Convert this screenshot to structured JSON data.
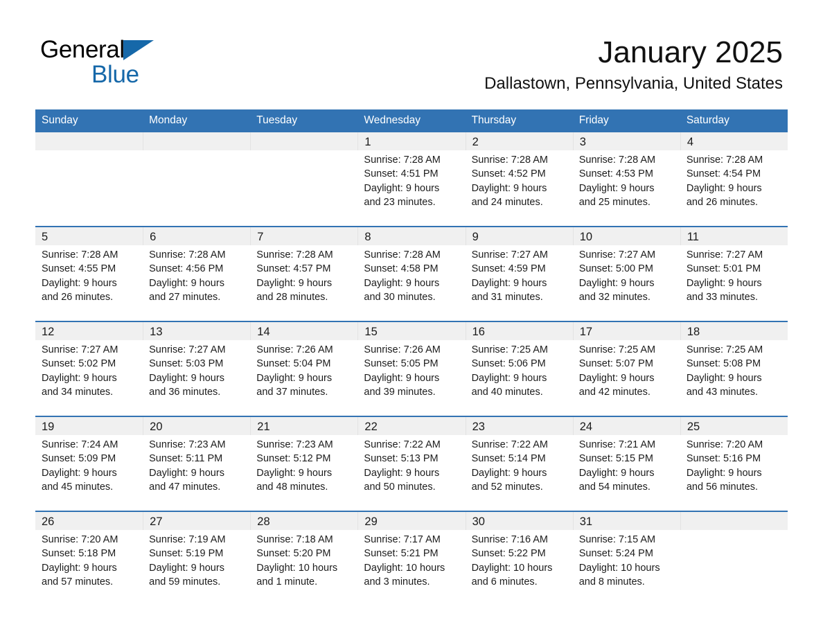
{
  "brand": {
    "name_part1": "General",
    "name_part2": "Blue",
    "triangle_color": "#1668A9"
  },
  "header": {
    "month_title": "January 2025",
    "location": "Dallastown, Pennsylvania, United States"
  },
  "colors": {
    "header_blue": "#3273B3",
    "daynum_band": "#f0f0f0",
    "row_divider": "#3273B3"
  },
  "weekday_headers": [
    "Sunday",
    "Monday",
    "Tuesday",
    "Wednesday",
    "Thursday",
    "Friday",
    "Saturday"
  ],
  "labels": {
    "sunrise_prefix": "Sunrise:",
    "sunset_prefix": "Sunset:",
    "daylight_prefix": "Daylight:"
  },
  "weeks": [
    [
      {
        "day": "",
        "empty": true
      },
      {
        "day": "",
        "empty": true
      },
      {
        "day": "",
        "empty": true
      },
      {
        "day": "1",
        "sunrise": "Sunrise: 7:28 AM",
        "sunset": "Sunset: 4:51 PM",
        "daylight_l1": "Daylight: 9 hours",
        "daylight_l2": "and 23 minutes."
      },
      {
        "day": "2",
        "sunrise": "Sunrise: 7:28 AM",
        "sunset": "Sunset: 4:52 PM",
        "daylight_l1": "Daylight: 9 hours",
        "daylight_l2": "and 24 minutes."
      },
      {
        "day": "3",
        "sunrise": "Sunrise: 7:28 AM",
        "sunset": "Sunset: 4:53 PM",
        "daylight_l1": "Daylight: 9 hours",
        "daylight_l2": "and 25 minutes."
      },
      {
        "day": "4",
        "sunrise": "Sunrise: 7:28 AM",
        "sunset": "Sunset: 4:54 PM",
        "daylight_l1": "Daylight: 9 hours",
        "daylight_l2": "and 26 minutes."
      }
    ],
    [
      {
        "day": "5",
        "sunrise": "Sunrise: 7:28 AM",
        "sunset": "Sunset: 4:55 PM",
        "daylight_l1": "Daylight: 9 hours",
        "daylight_l2": "and 26 minutes."
      },
      {
        "day": "6",
        "sunrise": "Sunrise: 7:28 AM",
        "sunset": "Sunset: 4:56 PM",
        "daylight_l1": "Daylight: 9 hours",
        "daylight_l2": "and 27 minutes."
      },
      {
        "day": "7",
        "sunrise": "Sunrise: 7:28 AM",
        "sunset": "Sunset: 4:57 PM",
        "daylight_l1": "Daylight: 9 hours",
        "daylight_l2": "and 28 minutes."
      },
      {
        "day": "8",
        "sunrise": "Sunrise: 7:28 AM",
        "sunset": "Sunset: 4:58 PM",
        "daylight_l1": "Daylight: 9 hours",
        "daylight_l2": "and 30 minutes."
      },
      {
        "day": "9",
        "sunrise": "Sunrise: 7:27 AM",
        "sunset": "Sunset: 4:59 PM",
        "daylight_l1": "Daylight: 9 hours",
        "daylight_l2": "and 31 minutes."
      },
      {
        "day": "10",
        "sunrise": "Sunrise: 7:27 AM",
        "sunset": "Sunset: 5:00 PM",
        "daylight_l1": "Daylight: 9 hours",
        "daylight_l2": "and 32 minutes."
      },
      {
        "day": "11",
        "sunrise": "Sunrise: 7:27 AM",
        "sunset": "Sunset: 5:01 PM",
        "daylight_l1": "Daylight: 9 hours",
        "daylight_l2": "and 33 minutes."
      }
    ],
    [
      {
        "day": "12",
        "sunrise": "Sunrise: 7:27 AM",
        "sunset": "Sunset: 5:02 PM",
        "daylight_l1": "Daylight: 9 hours",
        "daylight_l2": "and 34 minutes."
      },
      {
        "day": "13",
        "sunrise": "Sunrise: 7:27 AM",
        "sunset": "Sunset: 5:03 PM",
        "daylight_l1": "Daylight: 9 hours",
        "daylight_l2": "and 36 minutes."
      },
      {
        "day": "14",
        "sunrise": "Sunrise: 7:26 AM",
        "sunset": "Sunset: 5:04 PM",
        "daylight_l1": "Daylight: 9 hours",
        "daylight_l2": "and 37 minutes."
      },
      {
        "day": "15",
        "sunrise": "Sunrise: 7:26 AM",
        "sunset": "Sunset: 5:05 PM",
        "daylight_l1": "Daylight: 9 hours",
        "daylight_l2": "and 39 minutes."
      },
      {
        "day": "16",
        "sunrise": "Sunrise: 7:25 AM",
        "sunset": "Sunset: 5:06 PM",
        "daylight_l1": "Daylight: 9 hours",
        "daylight_l2": "and 40 minutes."
      },
      {
        "day": "17",
        "sunrise": "Sunrise: 7:25 AM",
        "sunset": "Sunset: 5:07 PM",
        "daylight_l1": "Daylight: 9 hours",
        "daylight_l2": "and 42 minutes."
      },
      {
        "day": "18",
        "sunrise": "Sunrise: 7:25 AM",
        "sunset": "Sunset: 5:08 PM",
        "daylight_l1": "Daylight: 9 hours",
        "daylight_l2": "and 43 minutes."
      }
    ],
    [
      {
        "day": "19",
        "sunrise": "Sunrise: 7:24 AM",
        "sunset": "Sunset: 5:09 PM",
        "daylight_l1": "Daylight: 9 hours",
        "daylight_l2": "and 45 minutes."
      },
      {
        "day": "20",
        "sunrise": "Sunrise: 7:23 AM",
        "sunset": "Sunset: 5:11 PM",
        "daylight_l1": "Daylight: 9 hours",
        "daylight_l2": "and 47 minutes."
      },
      {
        "day": "21",
        "sunrise": "Sunrise: 7:23 AM",
        "sunset": "Sunset: 5:12 PM",
        "daylight_l1": "Daylight: 9 hours",
        "daylight_l2": "and 48 minutes."
      },
      {
        "day": "22",
        "sunrise": "Sunrise: 7:22 AM",
        "sunset": "Sunset: 5:13 PM",
        "daylight_l1": "Daylight: 9 hours",
        "daylight_l2": "and 50 minutes."
      },
      {
        "day": "23",
        "sunrise": "Sunrise: 7:22 AM",
        "sunset": "Sunset: 5:14 PM",
        "daylight_l1": "Daylight: 9 hours",
        "daylight_l2": "and 52 minutes."
      },
      {
        "day": "24",
        "sunrise": "Sunrise: 7:21 AM",
        "sunset": "Sunset: 5:15 PM",
        "daylight_l1": "Daylight: 9 hours",
        "daylight_l2": "and 54 minutes."
      },
      {
        "day": "25",
        "sunrise": "Sunrise: 7:20 AM",
        "sunset": "Sunset: 5:16 PM",
        "daylight_l1": "Daylight: 9 hours",
        "daylight_l2": "and 56 minutes."
      }
    ],
    [
      {
        "day": "26",
        "sunrise": "Sunrise: 7:20 AM",
        "sunset": "Sunset: 5:18 PM",
        "daylight_l1": "Daylight: 9 hours",
        "daylight_l2": "and 57 minutes."
      },
      {
        "day": "27",
        "sunrise": "Sunrise: 7:19 AM",
        "sunset": "Sunset: 5:19 PM",
        "daylight_l1": "Daylight: 9 hours",
        "daylight_l2": "and 59 minutes."
      },
      {
        "day": "28",
        "sunrise": "Sunrise: 7:18 AM",
        "sunset": "Sunset: 5:20 PM",
        "daylight_l1": "Daylight: 10 hours",
        "daylight_l2": "and 1 minute."
      },
      {
        "day": "29",
        "sunrise": "Sunrise: 7:17 AM",
        "sunset": "Sunset: 5:21 PM",
        "daylight_l1": "Daylight: 10 hours",
        "daylight_l2": "and 3 minutes."
      },
      {
        "day": "30",
        "sunrise": "Sunrise: 7:16 AM",
        "sunset": "Sunset: 5:22 PM",
        "daylight_l1": "Daylight: 10 hours",
        "daylight_l2": "and 6 minutes."
      },
      {
        "day": "31",
        "sunrise": "Sunrise: 7:15 AM",
        "sunset": "Sunset: 5:24 PM",
        "daylight_l1": "Daylight: 10 hours",
        "daylight_l2": "and 8 minutes."
      },
      {
        "day": "",
        "empty": true
      }
    ]
  ]
}
